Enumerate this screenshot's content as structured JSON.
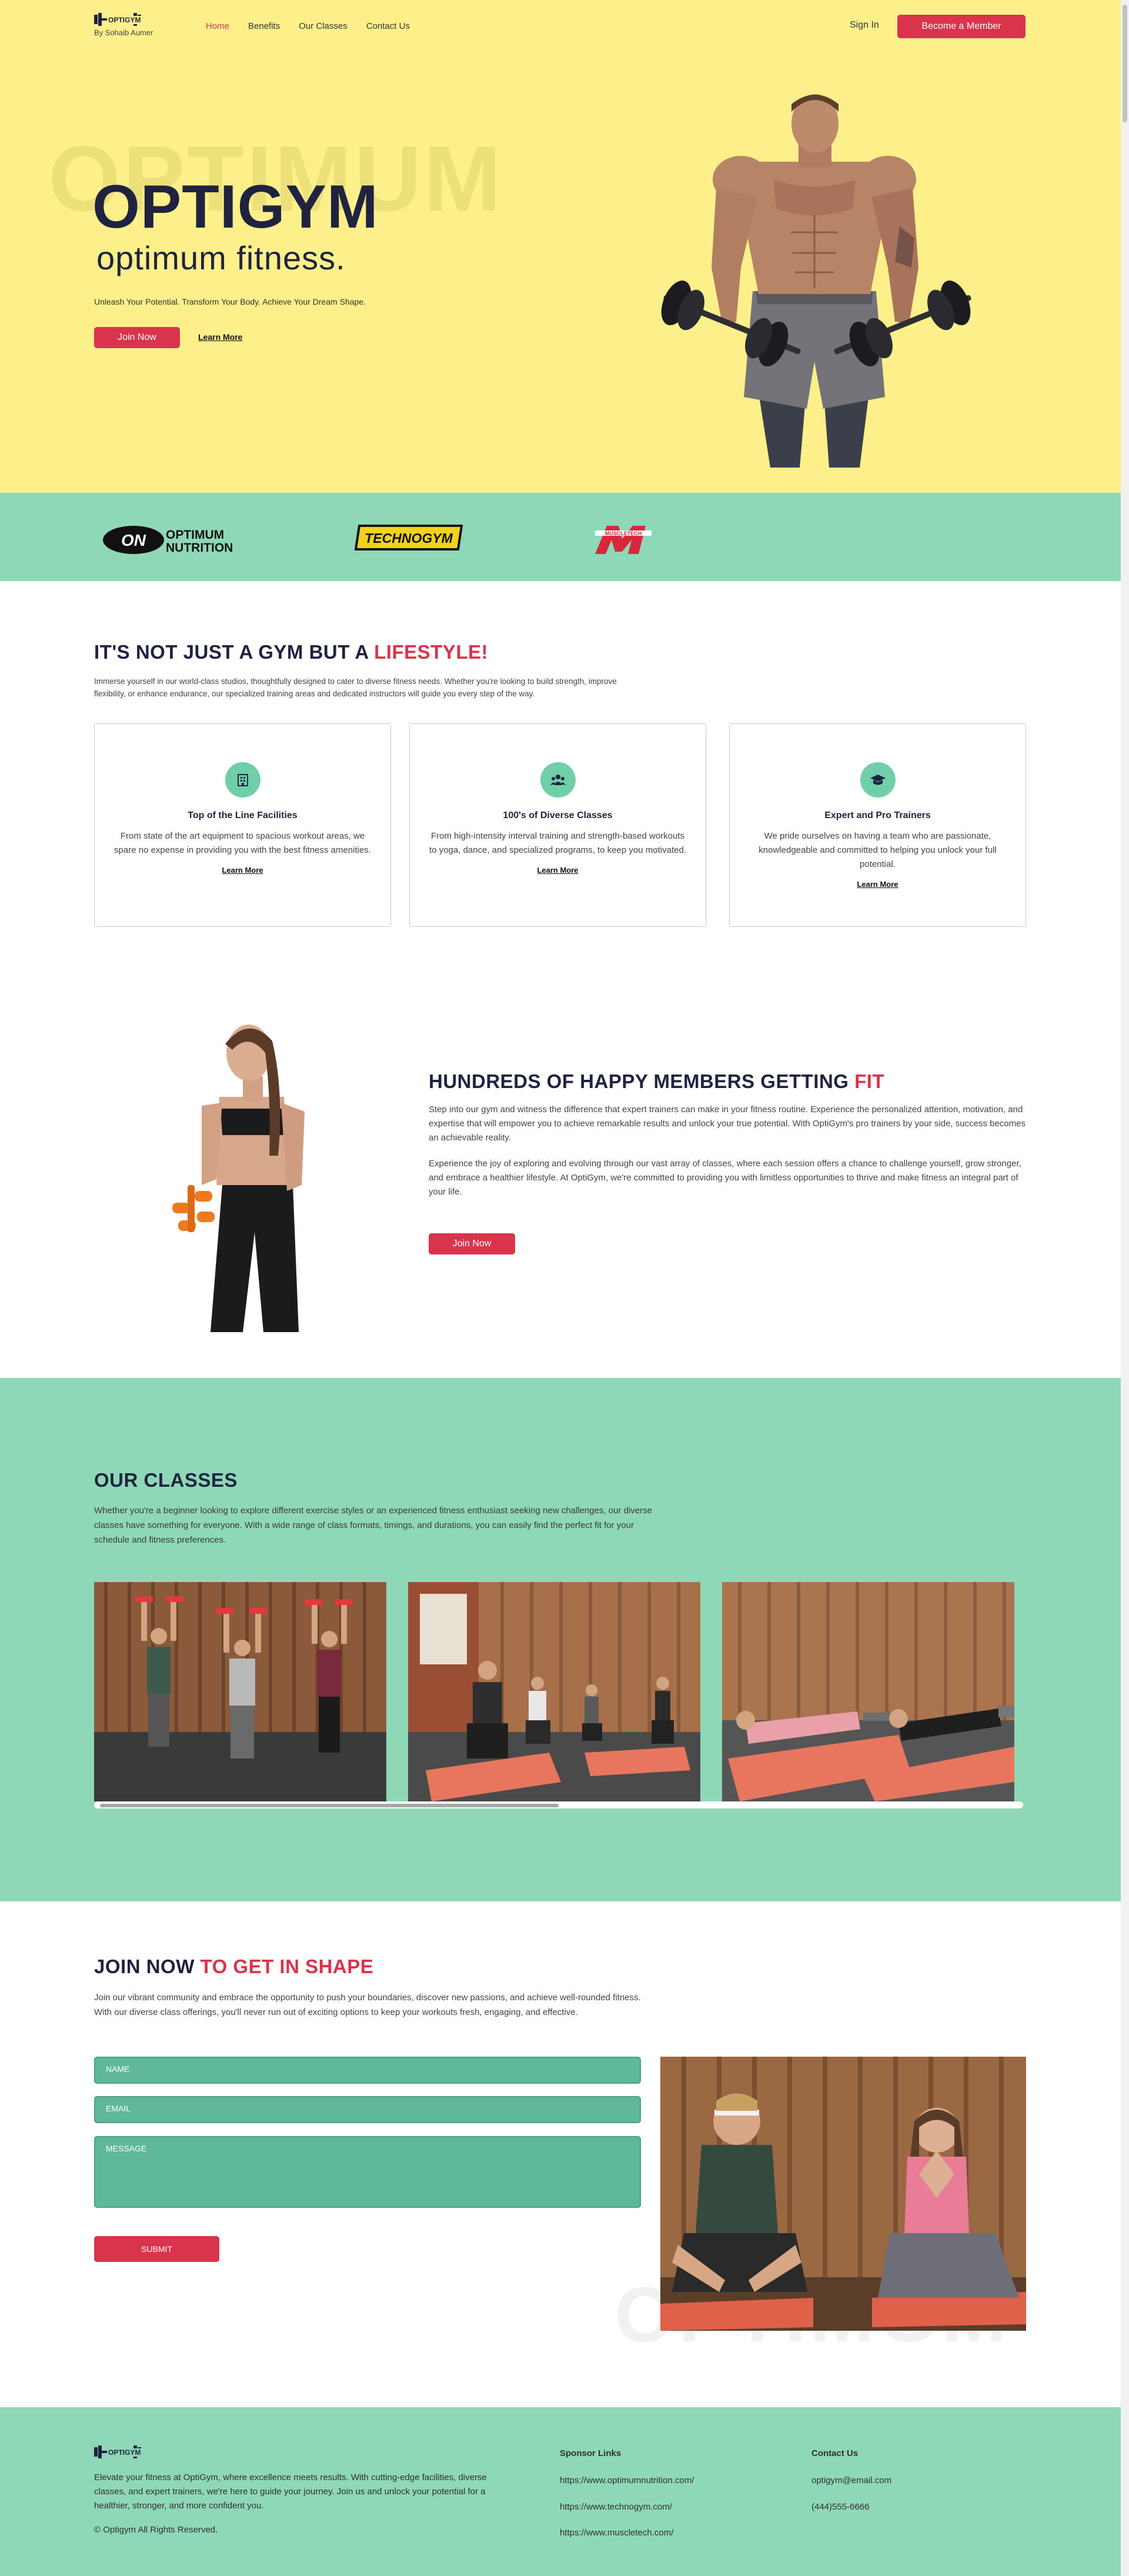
{
  "header": {
    "brand": "OPTIGYM",
    "byline": "By Sohaib Aumer",
    "nav": [
      "Home",
      "Benefits",
      "Our Classes",
      "Contact Us"
    ],
    "active_nav": "Home",
    "signin": "Sign In",
    "cta": "Become a Member"
  },
  "hero": {
    "watermark": "OPTIMUM",
    "title": "OPTIGYM",
    "subtitle": "optimum fitness.",
    "tagline": "Unleash Your Potential. Transform Your Body. Achieve Your Dream Shape.",
    "join": "Join Now",
    "learn": "Learn More"
  },
  "sponsors": {
    "on_badge": "ON",
    "on_line1": "OPTIMUM",
    "on_line2": "NUTRITION",
    "technogym": "TECHNOGYM",
    "muscletech": "MUSCLETECH"
  },
  "lifestyle": {
    "title_a": "IT'S NOT JUST A GYM BUT A ",
    "title_b": "LIFESTYLE!",
    "text": "Immerse yourself in our world-class studios, thoughtfully designed to cater to diverse fitness needs. Whether you're looking to build strength, improve flexibility, or enhance endurance, our specialized training areas and dedicated instructors will guide you every step of the way.",
    "cards": [
      {
        "title": "Top of the Line Facilities",
        "text": "From state of the art equipment to spacious workout areas, we spare no expense in providing you with the best fitness amenities.",
        "link": "Learn More",
        "icon": "building-icon"
      },
      {
        "title": "100's of Diverse Classes",
        "text": "From high-intensity interval training and strength-based workouts to yoga, dance, and specialized programs, to keep you motivated.",
        "link": "Learn More",
        "icon": "group-icon"
      },
      {
        "title": "Expert and Pro Trainers",
        "text": "We pride ourselves on having a team who are passionate, knowledgeable and committed to helping you unlock your full potential.",
        "link": "Learn More",
        "icon": "graduation-cap-icon"
      }
    ]
  },
  "happy": {
    "title_a": "HUNDREDS OF HAPPY MEMBERS GETTING ",
    "title_b": "FIT",
    "p1": "Step into our gym and witness the difference that expert trainers can make in your fitness routine. Experience the personalized attention, motivation, and expertise that will empower you to achieve remarkable results and unlock your true potential. With OptiGym's pro trainers by your side, success becomes an achievable reality.",
    "p2": "Experience the joy of exploring and evolving through our vast array of classes, where each session offers a chance to challenge yourself, grow stronger, and embrace a healthier lifestyle. At OptiGym, we're committed to providing you with limitless opportunities to thrive and make fitness an integral part of your life.",
    "join": "Join Now"
  },
  "classes": {
    "title": "OUR CLASSES",
    "text": "Whether you're a beginner looking to explore different exercise styles or an experienced fitness enthusiast seeking new challenges, our diverse classes have something for everyone. With a wide range of class formats, timings, and durations, you can easily find the perfect fit for your schedule and fitness preferences.",
    "scroll_fraction": 0.5
  },
  "join": {
    "title_a": "JOIN NOW ",
    "title_b": "TO GET IN SHAPE",
    "text": "Join our vibrant community and embrace the opportunity to push your boundaries, discover new passions, and achieve well-rounded fitness. With our diverse class offerings, you'll never run out of exciting options to keep your workouts fresh, engaging, and effective.",
    "name_placeholder": "NAME",
    "email_placeholder": "EMAIL",
    "message_placeholder": "MESSAGE",
    "submit": "SUBMIT",
    "watermark": "OPTIMGM"
  },
  "footer": {
    "brand": "OPTIGYM",
    "desc": "Elevate your fitness at OptiGym, where excellence meets results. With cutting-edge facilities, diverse classes, and expert trainers, we're here to guide your journey. Join us and unlock your potential for a healthier, stronger, and more confident you.",
    "copyright": "© Optigym All Rights Reserved.",
    "sponsor_heading": "Sponsor Links",
    "sponsor_links": [
      "https://www.optimumnutrition.com/",
      "https://www.technogym.com/",
      "https://www.muscletech.com/"
    ],
    "contact_heading": "Contact Us",
    "email": "optigym@email.com",
    "phone": "(444)555-6666"
  },
  "colors": {
    "yellow": "#fdf08b",
    "mint": "#8ed8b8",
    "red": "#d9344b",
    "navy": "#1f2340"
  }
}
